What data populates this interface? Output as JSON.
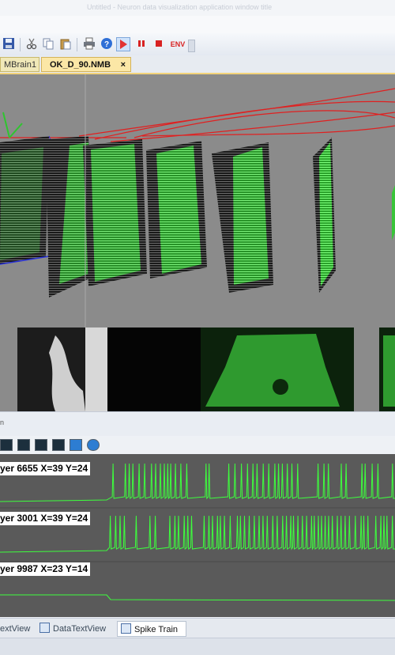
{
  "window": {
    "title": "Untitled - Neuron data visualization application window title"
  },
  "toolbar": {
    "buttons": [
      "save-icon",
      "cut-icon",
      "copy-icon",
      "paste-icon",
      "print-icon",
      "help-icon",
      "play-icon",
      "pause-icon",
      "stop-icon"
    ],
    "env_label": "ENV"
  },
  "doc_tabs": [
    {
      "label": "MBrain1",
      "active": false
    },
    {
      "label": "OK_D_90.NMB",
      "active": true
    }
  ],
  "doc_tab_close": "×",
  "panel": {
    "title_fragment": "n"
  },
  "spike_train": {
    "traces": [
      {
        "label": "yer 6655 X=39 Y=24",
        "color": "#3dff3d"
      },
      {
        "label": "yer 3001 X=39 Y=24",
        "color": "#3dff3d"
      },
      {
        "label": "yer 9987 X=23 Y=14",
        "color": "#3dff3d"
      }
    ]
  },
  "bottom_tabs": [
    {
      "label": "extView",
      "active": false
    },
    {
      "label": "DataTextView",
      "active": false
    },
    {
      "label": "Spike Train",
      "active": true
    }
  ],
  "colors": {
    "accent_tab": "#f3d37a",
    "spike_green": "#3dff3d",
    "view_bg": "#8b8b8b",
    "spike_bg": "#5a5a5a"
  }
}
